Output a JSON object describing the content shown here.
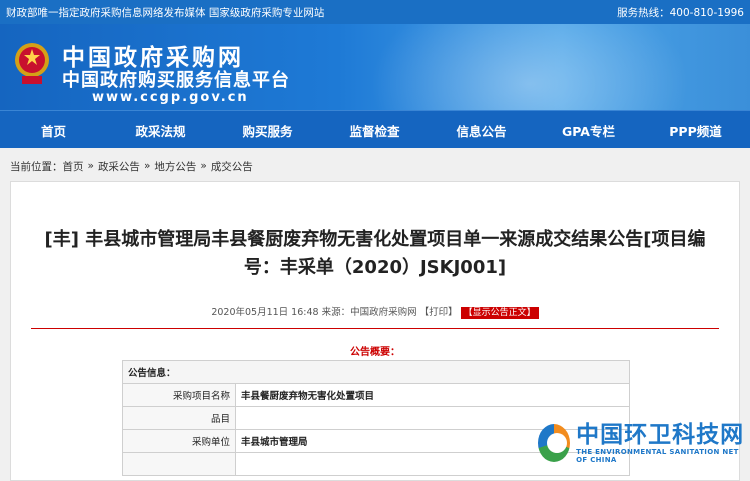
{
  "topbar": {
    "left": "财政部唯一指定政府采购信息网络发布媒体 国家级政府采购专业网站",
    "right": "服务热线：400-810-1996"
  },
  "header": {
    "logo_title": "中国政府采购网",
    "logo_subtitle": "中国政府购买服务信息平台",
    "url": "www.ccgp.gov.cn"
  },
  "nav": [
    "首页",
    "政采法规",
    "购买服务",
    "监督检查",
    "信息公告",
    "GPA专栏",
    "PPP频道"
  ],
  "breadcrumb": {
    "prefix": "当前位置：",
    "items": [
      "首页",
      "政采公告",
      "地方公告",
      "成交公告"
    ],
    "sep": "»"
  },
  "article": {
    "title": "[丰] 丰县城市管理局丰县餐厨废弃物无害化处置项目单一来源成交结果公告[项目编号：丰采单（2020）JSKJ001]",
    "meta": "2020年05月11日 16:48 来源：中国政府采购网 ",
    "print_label": "【打印】",
    "show_label": "【显示公告正文】",
    "summary_label": "公告概要："
  },
  "info_table": {
    "header": "公告信息：",
    "rows": [
      {
        "label": "采购项目名称",
        "value": "丰县餐厨废弃物无害化处置项目"
      },
      {
        "label": "品目",
        "value": ""
      },
      {
        "label": "采购单位",
        "value": "丰县城市管理局"
      },
      {
        "label": "",
        "value": ""
      }
    ]
  },
  "watermark": {
    "title": "中国环卫科技网",
    "subtitle": "THE ENVIRONMENTAL SANITATION NET OF CHINA"
  },
  "colors": {
    "brand_blue": "#1565c0",
    "accent_red": "#cc0000"
  }
}
